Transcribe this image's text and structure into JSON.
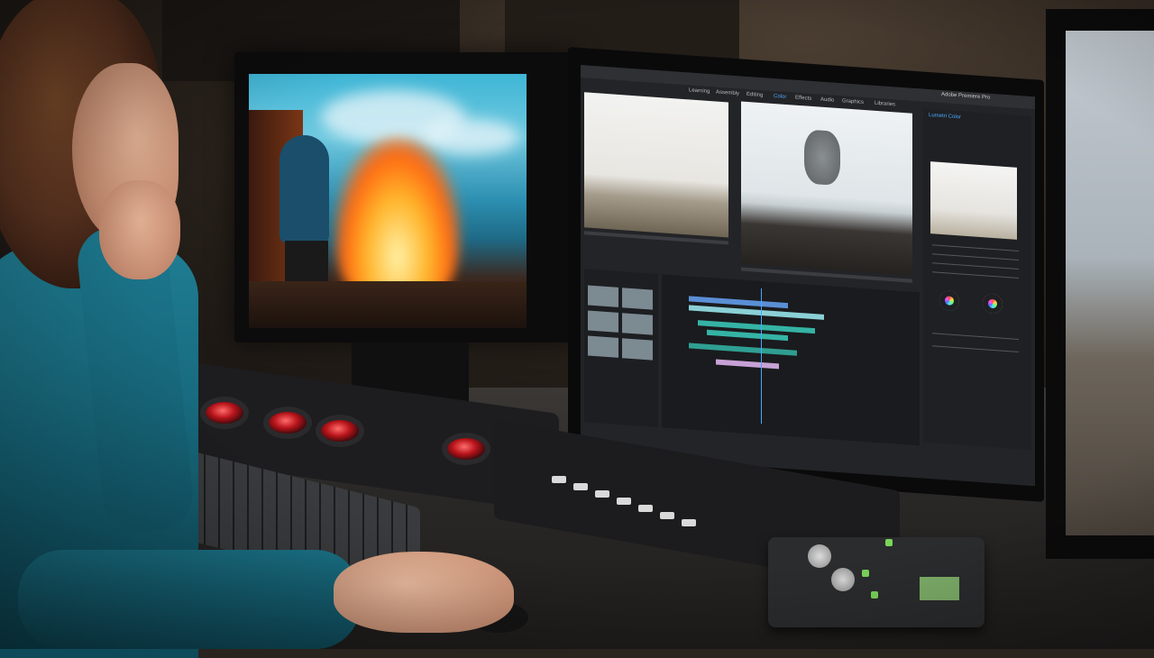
{
  "scene": {
    "description_free": true
  },
  "app": {
    "title": "Adobe Premiere Pro",
    "workspaces": [
      "Learning",
      "Assembly",
      "Editing",
      "Color",
      "Effects",
      "Audio",
      "Graphics",
      "Libraries"
    ],
    "active_workspace": "Color",
    "panels": {
      "lumetri": "Lumetri Color"
    }
  },
  "colors": {
    "accent": "#4aa8ff",
    "trackball": "#b8141a",
    "button_green": "#7bd65a"
  }
}
